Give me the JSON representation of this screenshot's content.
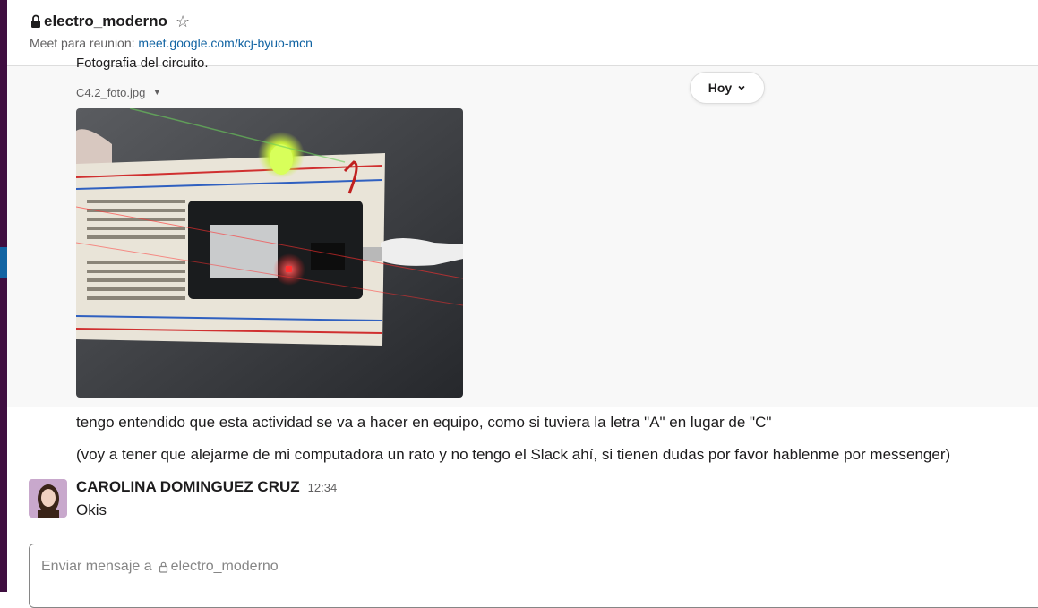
{
  "header": {
    "channel_name": "electro_moderno",
    "topic_prefix": "Meet para reunion:",
    "topic_link": "meet.google.com/kcj-byuo-mcn"
  },
  "messages": {
    "cut_text": "Fotografia del circuito.",
    "file_name": "C4.2_foto.jpg",
    "line1": "tengo entendido que esta actividad se va a hacer en equipo, como si tuviera la letra \"A\" en lugar de \"C\"",
    "line2": "(voy a tener que alejarme de mi computadora un rato y no tengo el Slack ahí, si tienen dudas por favor hablenme por messenger)",
    "reply_author": "CAROLINA DOMINGUEZ CRUZ",
    "reply_time": "12:34",
    "reply_text": "Okis"
  },
  "date_divider": {
    "label": "Hoy"
  },
  "composer": {
    "placeholder_prefix": "Enviar mensaje a",
    "placeholder_channel": "electro_moderno"
  },
  "colors": {
    "sidebar": "#3f0e40",
    "link": "#1264a3",
    "led": "#c8f03c"
  },
  "icons": [
    "lock-icon",
    "star-icon",
    "caret-down-icon",
    "chevron-down-icon"
  ]
}
